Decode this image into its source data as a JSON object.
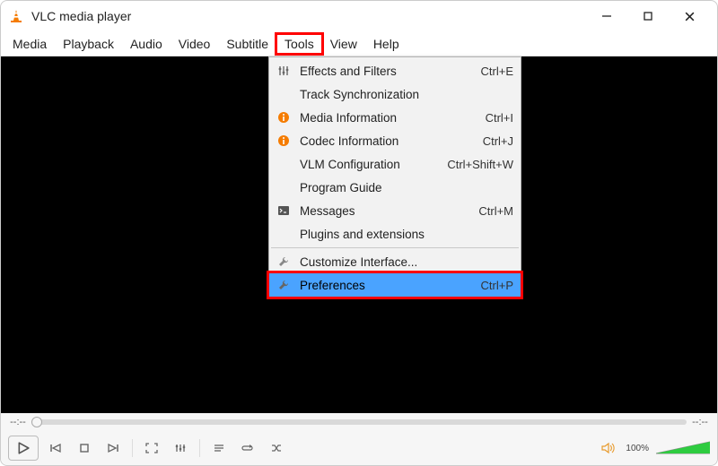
{
  "window": {
    "title": "VLC media player"
  },
  "menubar": {
    "items": [
      "Media",
      "Playback",
      "Audio",
      "Video",
      "Subtitle",
      "Tools",
      "View",
      "Help"
    ],
    "highlighted_index": 5
  },
  "tools_menu": {
    "rows": [
      {
        "icon": "sliders",
        "label": "Effects and Filters",
        "shortcut": "Ctrl+E"
      },
      {
        "icon": "",
        "label": "Track Synchronization",
        "shortcut": ""
      },
      {
        "icon": "info",
        "label": "Media Information",
        "shortcut": "Ctrl+I"
      },
      {
        "icon": "info",
        "label": "Codec Information",
        "shortcut": "Ctrl+J"
      },
      {
        "icon": "",
        "label": "VLM Configuration",
        "shortcut": "Ctrl+Shift+W"
      },
      {
        "icon": "",
        "label": "Program Guide",
        "shortcut": ""
      },
      {
        "icon": "terminal",
        "label": "Messages",
        "shortcut": "Ctrl+M"
      },
      {
        "icon": "",
        "label": "Plugins and extensions",
        "shortcut": ""
      }
    ],
    "rows2": [
      {
        "icon": "wrench",
        "label": "Customize Interface...",
        "shortcut": ""
      },
      {
        "icon": "wrench",
        "label": "Preferences",
        "shortcut": "Ctrl+P",
        "selected": true,
        "red": true
      }
    ]
  },
  "seek": {
    "left": "--:--",
    "right": "--:--"
  },
  "volume": {
    "label": "100%"
  }
}
